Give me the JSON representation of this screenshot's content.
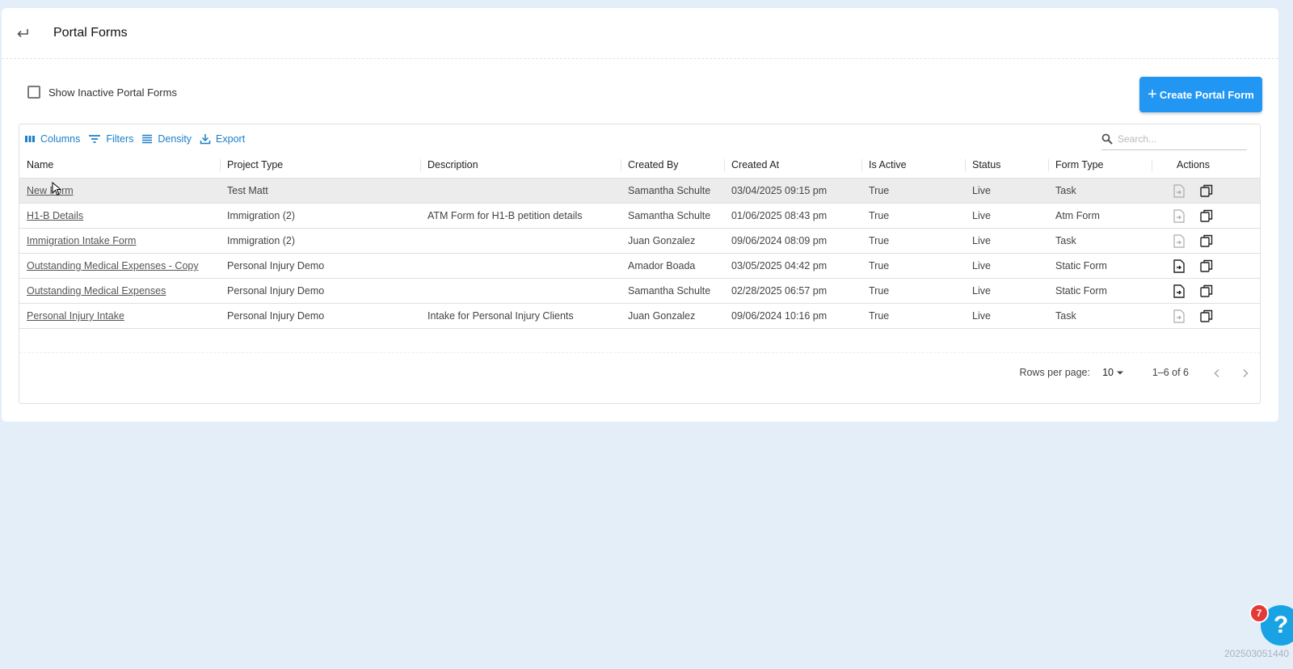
{
  "header": {
    "title": "Portal Forms"
  },
  "filters": {
    "show_inactive_label": "Show Inactive Portal Forms",
    "show_inactive_checked": false
  },
  "create_button": {
    "label": "Create Portal Form",
    "color": "#2196f3"
  },
  "grid_toolbar": {
    "columns_label": "Columns",
    "filters_label": "Filters",
    "density_label": "Density",
    "export_label": "Export",
    "search_placeholder": "Search..."
  },
  "columns": [
    "Name",
    "Project Type",
    "Description",
    "Created By",
    "Created At",
    "Is Active",
    "Status",
    "Form Type",
    "Actions"
  ],
  "rows": [
    {
      "name": "New Form",
      "project_type": "Test Matt",
      "description": "",
      "created_by": "Samantha Schulte",
      "created_at": "03/04/2025 09:15 pm",
      "is_active": "True",
      "status": "Live",
      "form_type": "Task",
      "export_enabled": false
    },
    {
      "name": "H1-B Details",
      "project_type": "Immigration (2)",
      "description": "ATM Form for H1-B petition details",
      "created_by": "Samantha Schulte",
      "created_at": "01/06/2025 08:43 pm",
      "is_active": "True",
      "status": "Live",
      "form_type": "Atm Form",
      "export_enabled": false
    },
    {
      "name": "Immigration Intake Form",
      "project_type": "Immigration (2)",
      "description": "",
      "created_by": "Juan Gonzalez",
      "created_at": "09/06/2024 08:09 pm",
      "is_active": "True",
      "status": "Live",
      "form_type": "Task",
      "export_enabled": false
    },
    {
      "name": "Outstanding Medical Expenses - Copy",
      "project_type": "Personal Injury Demo",
      "description": "",
      "created_by": "Amador Boada",
      "created_at": "03/05/2025 04:42 pm",
      "is_active": "True",
      "status": "Live",
      "form_type": "Static Form",
      "export_enabled": true
    },
    {
      "name": "Outstanding Medical Expenses",
      "project_type": "Personal Injury Demo",
      "description": "",
      "created_by": "Samantha Schulte",
      "created_at": "02/28/2025 06:57 pm",
      "is_active": "True",
      "status": "Live",
      "form_type": "Static Form",
      "export_enabled": true
    },
    {
      "name": "Personal Injury Intake",
      "project_type": "Personal Injury Demo",
      "description": "Intake for Personal Injury Clients",
      "created_by": "Juan Gonzalez",
      "created_at": "09/06/2024 10:16 pm",
      "is_active": "True",
      "status": "Live",
      "form_type": "Task",
      "export_enabled": false
    }
  ],
  "pagination": {
    "rows_per_page_label": "Rows per page:",
    "rows_per_page": "10",
    "range_text": "1–6 of 6"
  },
  "help": {
    "badge_count": "7",
    "icon": "question-mark-icon",
    "color": "#19a3e4"
  },
  "version": "202503051440"
}
